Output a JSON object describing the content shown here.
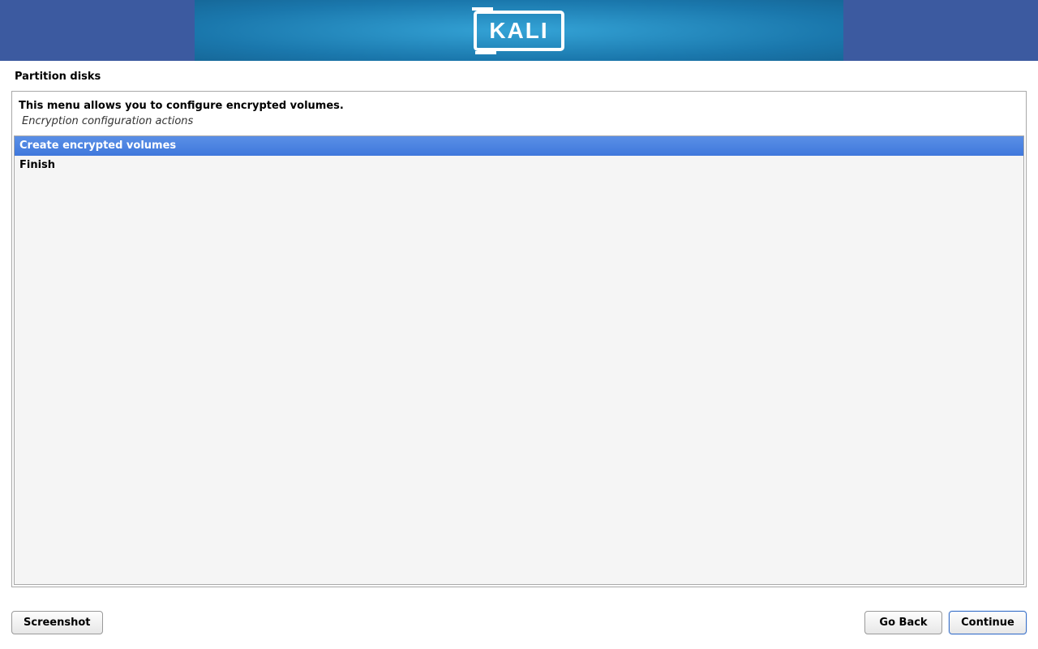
{
  "brand": "KALI",
  "page_title": "Partition disks",
  "instruction": "This menu allows you to configure encrypted volumes.",
  "subhead": "Encryption configuration actions",
  "options": [
    {
      "label": "Create encrypted volumes",
      "selected": true
    },
    {
      "label": "Finish",
      "selected": false
    }
  ],
  "buttons": {
    "screenshot": "Screenshot",
    "go_back": "Go Back",
    "continue": "Continue"
  }
}
